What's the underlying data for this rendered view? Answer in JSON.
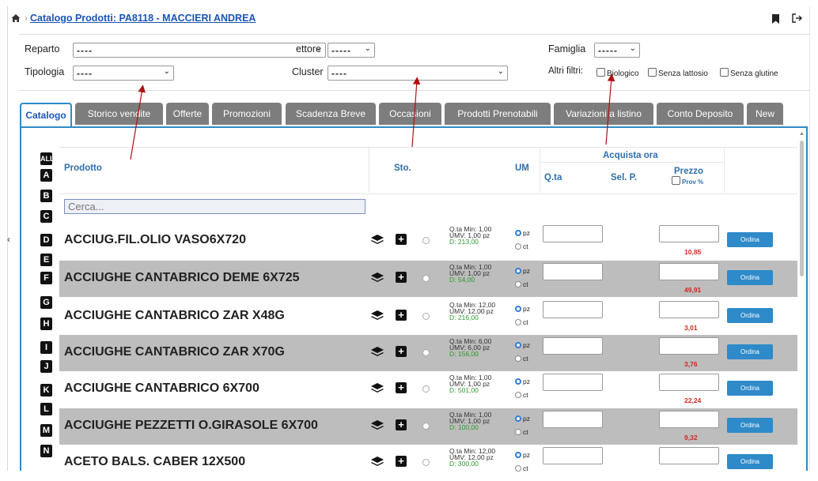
{
  "header": {
    "breadcrumb": "Catalogo Prodotti: PA8118 - MACCIERI ANDREA"
  },
  "filters": {
    "reparto_label": "Reparto",
    "reparto_value": "----",
    "settore_label": "ettore",
    "settore_value": "-----",
    "famiglia_label": "Famiglia",
    "famiglia_value": "-----",
    "tipologia_label": "Tipologia",
    "tipologia_value": "----",
    "cluster_label": "Cluster",
    "cluster_value": "----",
    "altri_label": "Altri filtri:",
    "opt1": "Biologico",
    "opt2": "Senza lattosio",
    "opt3": "Senza glutine"
  },
  "tabs": [
    "Catalogo",
    "Storico vendite",
    "Offerte",
    "Promozioni",
    "Scadenza Breve",
    "Occasioni",
    "Prodotti Prenotabili",
    "Variazioni a listino",
    "Conto Deposito",
    "New"
  ],
  "alphabet": [
    "ALL",
    "A",
    "B",
    "C",
    "D",
    "E",
    "F",
    "G",
    "H",
    "I",
    "J",
    "K",
    "L",
    "M",
    "N"
  ],
  "table": {
    "prodotto": "Prodotto",
    "sto": "Sto.",
    "um": "UM",
    "acquista": "Acquista ora",
    "qta": "Q.ta",
    "selp": "Sel. P.",
    "prezzo": "Prezzo",
    "prov": "Prov %",
    "search_placeholder": "Cerca..."
  },
  "rows": [
    {
      "name": "ACCIUG.FIL.OLIO VASO6X720",
      "min": "Q.ta Min: 1,00",
      "umv": "UMV: 1,00 pz",
      "d": "D: 213,00",
      "price": "10,85"
    },
    {
      "name": "ACCIUGHE CANTABRICO DEME 6X725",
      "min": "Q.ta Min: 1,00",
      "umv": "UMV: 1,00 pz",
      "d": "D: 54,00",
      "price": "49,91"
    },
    {
      "name": "ACCIUGHE CANTABRICO ZAR  X48G",
      "min": "Q.ta Min: 12,00",
      "umv": "UMV: 12,00 pz",
      "d": "D: 216,00",
      "price": "3,01"
    },
    {
      "name": "ACCIUGHE CANTABRICO ZAR  X70G",
      "min": "Q.ta Min: 6,00",
      "umv": "UMV: 6,00 pz",
      "d": "D: 156,00",
      "price": "3,76"
    },
    {
      "name": "ACCIUGHE CANTABRICO 6X700",
      "min": "Q.ta Min: 1,00",
      "umv": "UMV: 1,00 pz",
      "d": "D: 501,00",
      "price": "22,24"
    },
    {
      "name": "ACCIUGHE PEZZETTI O.GIRASOLE 6X700",
      "min": "Q.ta Min: 1,00",
      "umv": "UMV: 1,00 pz",
      "d": "D: 100,00",
      "price": "9,32"
    },
    {
      "name": "ACETO BALS. CABER  12X500",
      "min": "Q.ta Min: 12,00",
      "umv": "UMV: 12,00 pz",
      "d": "D: 300,00",
      "price": ""
    }
  ],
  "row_common": {
    "pz": "pz",
    "ct": "ct",
    "ordina": "Ordina"
  },
  "colors": {
    "accent": "#2e8ac8",
    "price": "#d9251d",
    "tab": "#7d7d7d",
    "arrow": "#b01010"
  }
}
